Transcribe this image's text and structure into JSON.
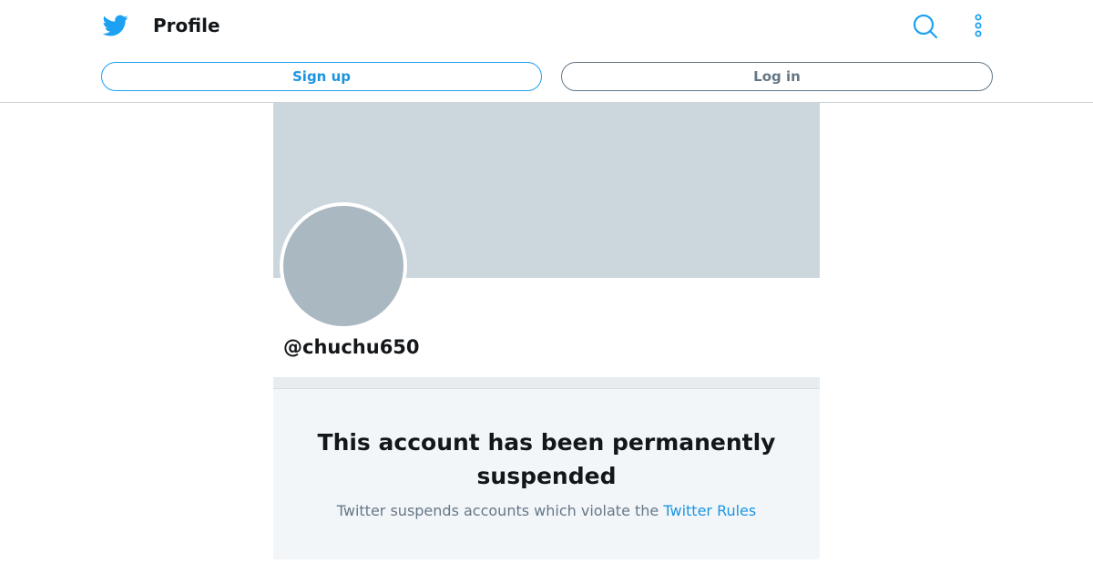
{
  "header": {
    "title": "Profile",
    "logo_icon": "twitter-bird-icon",
    "search_icon": "search-icon",
    "more_icon": "more-vertical-icon",
    "accent_color": "#1da1f2"
  },
  "auth": {
    "signup_label": "Sign up",
    "login_label": "Log in"
  },
  "profile": {
    "handle": "@chuchu650",
    "avatar_icon": "default-avatar",
    "banner_color": "#ccd6dd",
    "avatar_color": "#aab8c2"
  },
  "suspension": {
    "title": "This account has been permanently suspended",
    "description": "Twitter suspends accounts which violate the",
    "rules_link": "Twitter Rules"
  }
}
